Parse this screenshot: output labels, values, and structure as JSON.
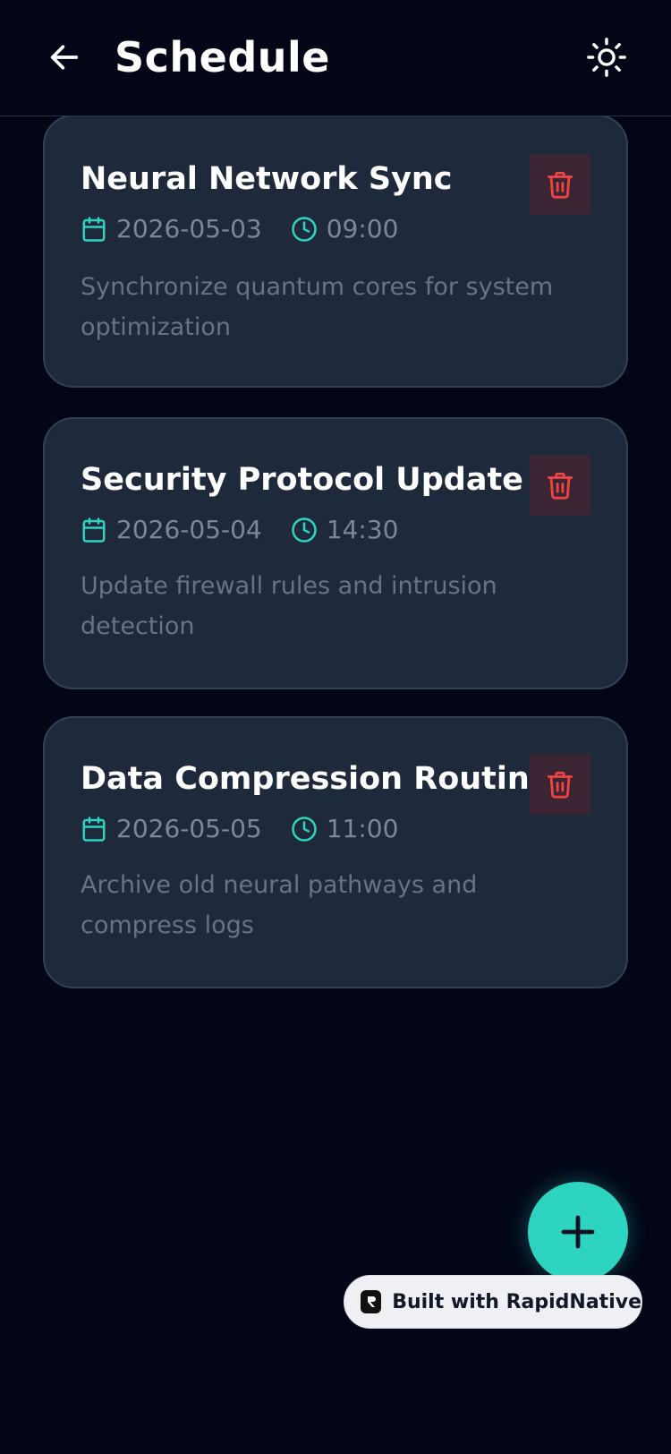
{
  "header": {
    "title": "Schedule",
    "back_icon": "arrow-left-icon",
    "theme_icon": "sun-icon"
  },
  "events": [
    {
      "title": "Neural Network Sync",
      "date": "2026-05-03",
      "time": "09:00",
      "description": "Synchronize quantum cores for system optimization"
    },
    {
      "title": "Security Protocol Update",
      "date": "2026-05-04",
      "time": "14:30",
      "description": "Update firewall rules and intrusion detection"
    },
    {
      "title": "Data Compression Routine",
      "date": "2026-05-05",
      "time": "11:00",
      "description": "Archive old neural pathways and compress logs"
    }
  ],
  "fab": {
    "icon": "plus-icon"
  },
  "badge": {
    "label": "Built with RapidNative"
  },
  "colors": {
    "background": "#020617",
    "card": "#1e293b",
    "accent": "#2dd4bf",
    "danger": "#ef4444"
  }
}
